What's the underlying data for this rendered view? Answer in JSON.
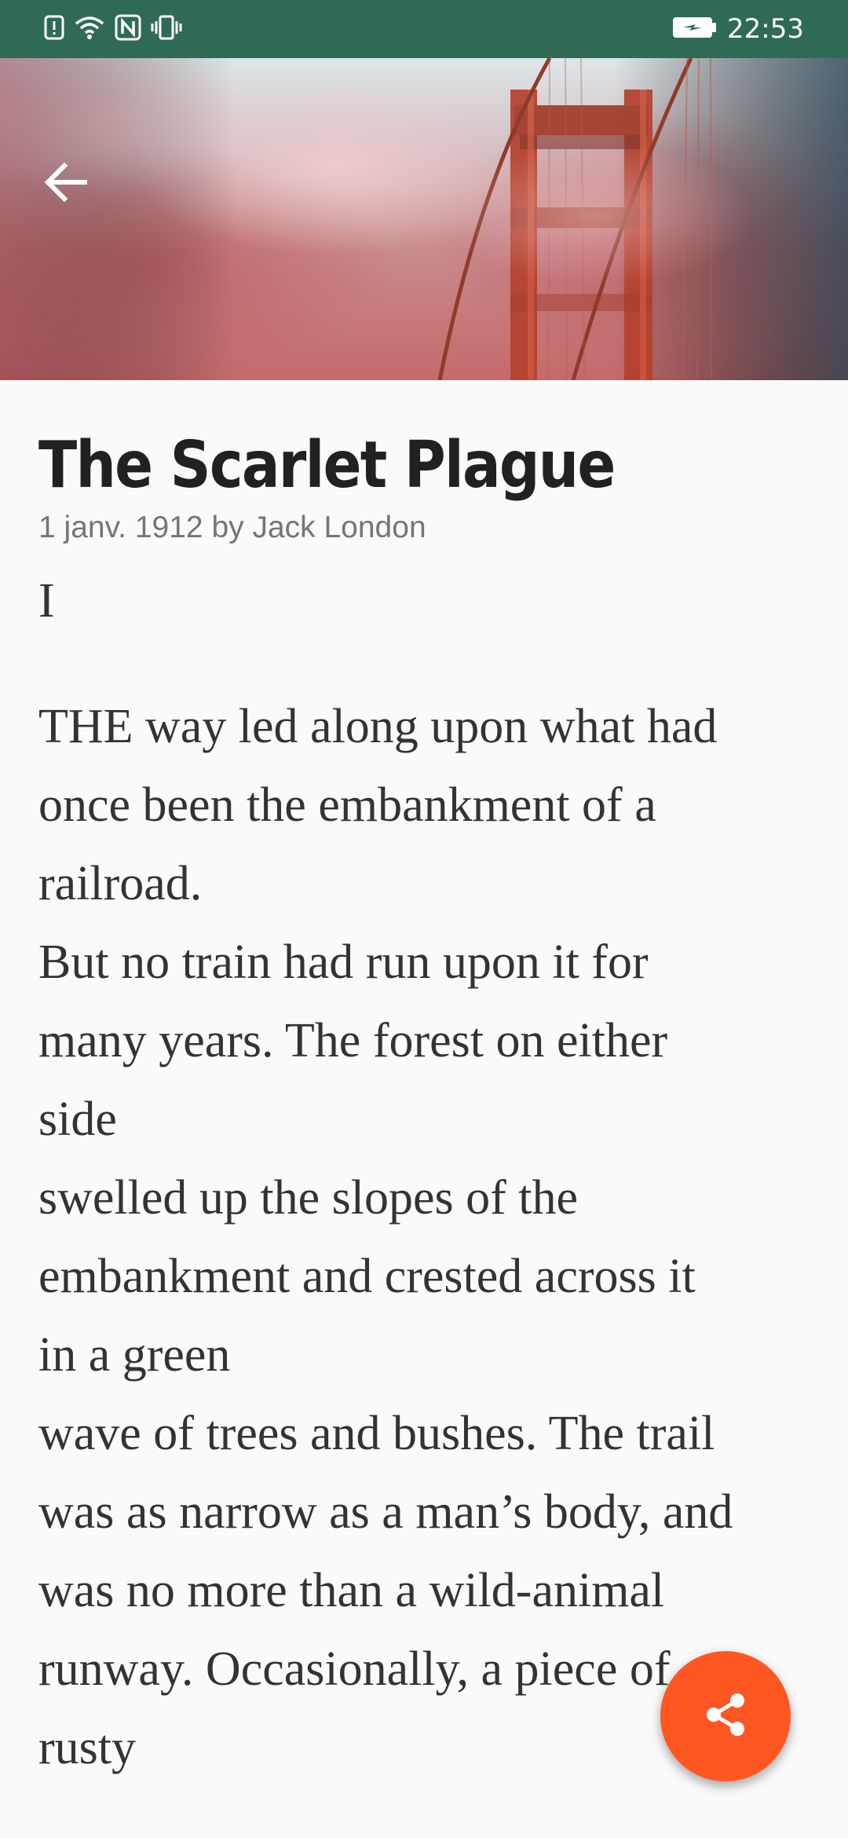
{
  "status_bar": {
    "time": "22:53",
    "icons": [
      "alert-icon",
      "wifi-icon",
      "nfc-icon",
      "vibrate-icon",
      "battery-charging-icon"
    ]
  },
  "header": {
    "image": "golden-gate-bridge-fog-image",
    "back_icon": "back-arrow-icon"
  },
  "article": {
    "title": "The Scarlet Plague",
    "meta": "1 janv. 1912 by Jack London",
    "chapter": "I",
    "lines": [
      "THE way led along upon what had",
      "once been the embankment of a",
      "railroad.",
      "But no train had run upon it for",
      "many years. The forest on either",
      "side",
      "swelled up the slopes of the",
      "embankment and crested across it",
      "in a green",
      "wave of trees and bushes. The trail",
      "was as narrow as a man’s body, and",
      "was no more than a wild-animal",
      "runway. Occasionally, a piece of",
      "rusty"
    ]
  },
  "fab": {
    "icon": "share-icon",
    "color": "#ff5722"
  }
}
